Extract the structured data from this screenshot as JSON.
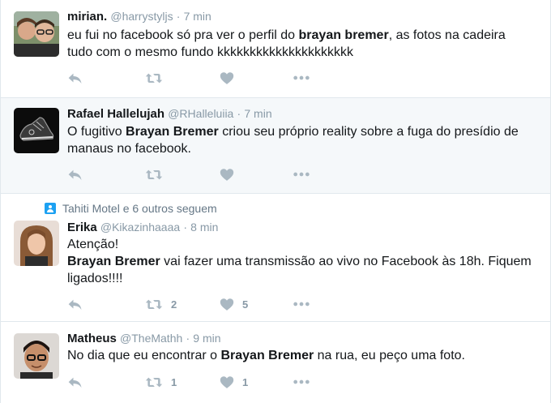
{
  "colors": {
    "text": "#14171a",
    "muted": "#8899a6",
    "action_icon": "#aab8c2",
    "accent": "#1da1f2",
    "highlight_bg": "#f5f8fa"
  },
  "tweets": [
    {
      "name": "mirian.",
      "handle": "@harrystyljs",
      "sep": "·",
      "time": "7 min",
      "text_parts": [
        "eu fui no facebook só pra ver o perfil do ",
        "brayan bremer",
        ", as fotos na cadeira tudo com o mesmo fundo kkkkkkkkkkkkkkkkkkkkk"
      ],
      "avatar_icon": "user-photo-icon",
      "retweets": "",
      "likes": ""
    },
    {
      "name": "Rafael Hallelujah",
      "handle": "@RHalleluiia",
      "sep": "·",
      "time": "7 min",
      "text_parts": [
        "O fugitivo ",
        "Brayan Bremer",
        " criou seu  próprio reality sobre a fuga do presídio de manaus no facebook."
      ],
      "avatar_icon": "sneaker-photo-icon",
      "retweets": "",
      "likes": ""
    },
    {
      "social_context": "Tahiti Motel e 6 outros seguem",
      "name": "Erika",
      "handle": "@Kikazinhaaaa",
      "sep": "·",
      "time": "8 min",
      "line1": "Atenção!",
      "text_parts": [
        "Brayan Bremer",
        " vai fazer uma transmissão ao vivo no Facebook às 18h. Fiquem ligados!!!!"
      ],
      "avatar_icon": "user-photo-icon",
      "retweets": "2",
      "likes": "5"
    },
    {
      "name": "Matheus",
      "handle": "@TheMathh",
      "sep": "·",
      "time": "9 min",
      "text_parts": [
        "No dia que eu encontrar o ",
        "Brayan Bremer",
        " na rua, eu peço uma foto."
      ],
      "avatar_icon": "user-photo-icon",
      "retweets": "1",
      "likes": "1"
    }
  ]
}
